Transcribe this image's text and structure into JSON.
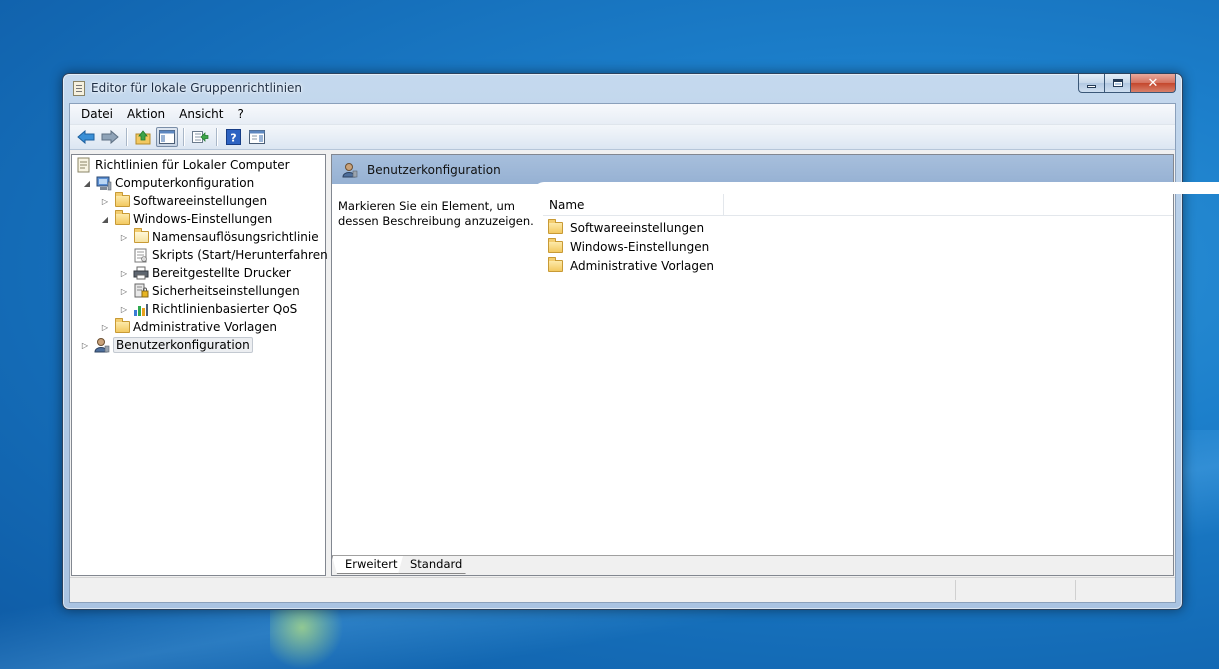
{
  "window": {
    "title": "Editor für lokale Gruppenrichtlinien",
    "caption_close": "✕"
  },
  "menu": [
    "Datei",
    "Aktion",
    "Ansicht",
    "?"
  ],
  "toolbar": {
    "icons": [
      "back-arrow-icon",
      "forward-arrow-icon",
      "up-folder-icon",
      "show-hide-console-tree-icon",
      "export-list-icon",
      "help-icon",
      "show-hide-action-pane-icon"
    ]
  },
  "tree": {
    "root": "Richtlinien für Lokaler Computer",
    "computer_config": "Computerkonfiguration",
    "software_settings": "Softwareeinstellungen",
    "windows_settings": "Windows-Einstellungen",
    "name_resolution": "Namensauflösungsrichtlinie",
    "scripts": "Skripts (Start/Herunterfahren)",
    "printers": "Bereitgestellte Drucker",
    "security": "Sicherheitseinstellungen",
    "qos": "Richtlinienbasierter QoS",
    "admin_templates": "Administrative Vorlagen",
    "user_config": "Benutzerkonfiguration"
  },
  "right_pane": {
    "header_title": "Benutzerkonfiguration",
    "description": "Markieren Sie ein Element, um dessen Beschreibung anzuzeigen.",
    "column_name": "Name",
    "items": [
      "Softwareeinstellungen",
      "Windows-Einstellungen",
      "Administrative Vorlagen"
    ]
  },
  "tabs": {
    "extended": "Erweitert",
    "standard": "Standard"
  }
}
